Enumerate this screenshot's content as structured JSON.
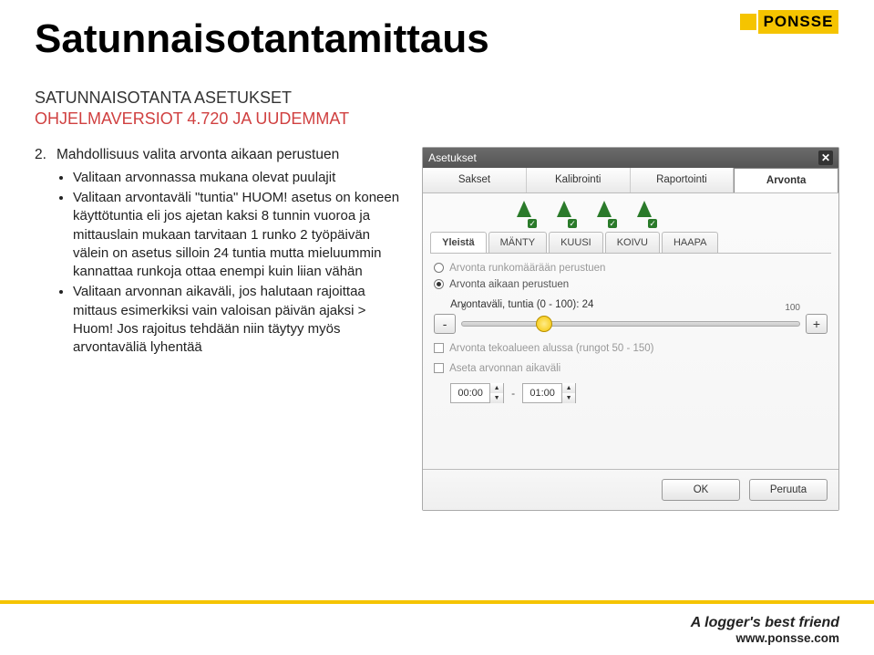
{
  "brand": {
    "name": "PONSSE"
  },
  "title": "Satunnaisotantamittaus",
  "subtitle": {
    "line1": "SATUNNAISOTANTA ASETUKSET",
    "line2": "OHJELMAVERSIOT 4.720 JA UUDEMMAT"
  },
  "item2": {
    "num": "2.",
    "head": "Mahdollisuus valita arvonta aikaan perustuen",
    "b1": "Valitaan arvonnassa mukana olevat puulajit",
    "b2": "Valitaan arvontaväli \"tuntia\" HUOM! asetus on koneen käyttötuntia eli jos ajetan kaksi 8 tunnin vuoroa ja mittauslain mukaan tarvitaan 1 runko 2 työpäivän välein on asetus silloin 24 tuntia mutta mieluummin kannattaa runkoja ottaa enempi kuin liian vähän",
    "b3": "Valitaan arvonnan aikaväli, jos halutaan rajoittaa mittaus esimerkiksi vain valoisan päivän ajaksi > Huom! Jos rajoitus tehdään niin täytyy myös arvontaväliä lyhentää"
  },
  "panel": {
    "header": "Asetukset",
    "tabs": {
      "t1": "Sakset",
      "t2": "Kalibrointi",
      "t3": "Raportointi",
      "t4": "Arvonta"
    },
    "species": {
      "s0": "Yleistä",
      "s1": "MÄNTY",
      "s2": "KUUSI",
      "s3": "KOIVU",
      "s4": "HAAPA"
    },
    "radio1": "Arvonta runkomäärään perustuen",
    "radio2": "Arvonta aikaan perustuen",
    "interval_label": "Arvontaväli, tuntia (0 - 100): 24",
    "slider_min": "0",
    "slider_max": "100",
    "minus": "-",
    "plus": "+",
    "chk1": "Arvonta tekoalueen alussa (rungot 50 - 150)",
    "chk2": "Aseta arvonnan aikaväli",
    "time_from": "00:00",
    "time_to": "01:00",
    "dash": "-",
    "ok": "OK",
    "cancel": "Peruuta"
  },
  "footer": {
    "tagline": "A logger's best friend",
    "site": "www.ponsse.com"
  }
}
